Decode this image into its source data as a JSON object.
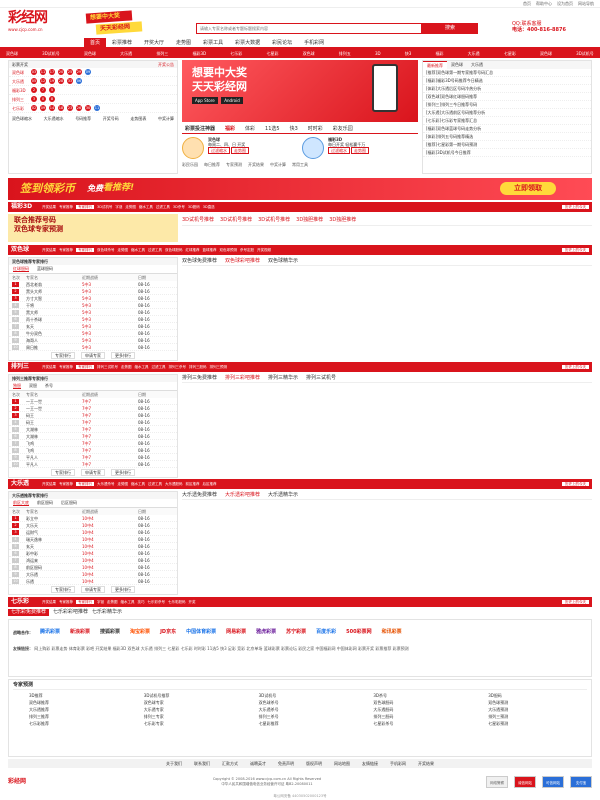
{
  "top_links": [
    "首页",
    "帮助中心",
    "设为首页",
    "网站导航"
  ],
  "header": {
    "logo_text": "彩经网",
    "logo_url": "www.cjcp.com.cn",
    "slogan1": "想要中大奖",
    "slogan2": "天天彩经网",
    "search_placeholder": "请输入专家名称或者专题标题搜索内容",
    "search_button": "搜索",
    "hotline_label": "QQ:联系客服",
    "hotline_number": "电话：400-816-8876"
  },
  "nav": {
    "items": [
      "首页",
      "彩票推荐",
      "开奖大厅",
      "走势图",
      "彩票工具",
      "彩票大数据",
      "彩民论坛",
      "手机彩网"
    ],
    "active_index": 0
  },
  "subnav": [
    "双色球",
    "3D试机号",
    "双色球",
    "大乐透",
    "排列三",
    "福彩3D",
    "七乐彩",
    "七星彩",
    "双色球",
    "排列五",
    "3D",
    "快3",
    "福彩",
    "大乐透",
    "七星彩",
    "双色球",
    "3D试机号"
  ],
  "draws": {
    "head_left": "彩票开奖",
    "head_right": "开奖公告",
    "rows": [
      {
        "name": "双色球",
        "balls": [
          "03",
          "11",
          "17",
          "20",
          "25",
          "29"
        ],
        "blue": "09"
      },
      {
        "name": "大乐透",
        "balls": [
          "05",
          "12",
          "19",
          "28",
          "33"
        ],
        "blue": "06"
      },
      {
        "name": "福彩3D",
        "balls": [
          "2",
          "7",
          "5"
        ],
        "blue": ""
      },
      {
        "name": "排列三",
        "balls": [
          "3",
          "0",
          "8"
        ],
        "blue": ""
      },
      {
        "name": "七乐彩",
        "balls": [
          "02",
          "09",
          "14",
          "18",
          "23",
          "26",
          "30"
        ],
        "blue": "11"
      }
    ],
    "tools": [
      "双色球缩水",
      "大乐透缩水",
      "号码推荐",
      "开奖号码",
      "走势图表",
      "中奖计算"
    ]
  },
  "banner": {
    "line1": "想要中大奖",
    "line2": "天天彩经网",
    "store1": "App Store",
    "store2": "Android"
  },
  "tools": {
    "title": "彩票投注神器",
    "tabs": [
      "福彩",
      "体彩",
      "11选5",
      "快3",
      "时时彩",
      "彩友乐园"
    ],
    "active": 0,
    "block1": {
      "name": "双色球",
      "desc": "每周二、四、日 开奖",
      "tags": [
        "过滤缩水",
        "走势图"
      ]
    },
    "block2": {
      "name": "福彩3D",
      "desc": "每日开奖 轻松赢千万",
      "tags": [
        "过滤缩水",
        "走势图"
      ]
    },
    "links": [
      "彩民乐园",
      "每日推荐",
      "专家预测",
      "开奖结果",
      "中奖计算",
      "常用工具"
    ]
  },
  "news": {
    "tabs": [
      "最新推荐",
      "双色球",
      "大乐透"
    ],
    "active": 0,
    "items": [
      "[推荐]双色球第一期专家推荐号码汇总",
      "[福彩]福彩3D号码推荐今日精选",
      "[体彩]大乐透后区号码冷热分析",
      "[双色球]双色球红球胆码推荐",
      "[排列三]排列三今日推荐号码",
      "[大乐透]大乐透前区号码推荐分析",
      "[七乐彩]七乐彩专家推荐汇总",
      "[福彩]双色球蓝球号码走势分析",
      "[体彩]排列五号码推荐精选",
      "[推荐]七星彩第一期号码预测",
      "[福彩]3D试机号今日推荐"
    ]
  },
  "promo": {
    "part1": "签到领彩币",
    "part2": "免费",
    "part3": "看推荐!",
    "button": "立即领取"
  },
  "sections": {
    "fc3d": {
      "name": "福彩3D",
      "links": [
        "开奖结果",
        "专家推荐",
        "专家排行",
        "3D试机号",
        "字谜",
        "走势图",
        "缩水工具",
        "过滤工具",
        "3D杀号",
        "3D胆码",
        "3D直选"
      ],
      "more": "历史上的今天",
      "ad1": "联合推荐号码",
      "ad2": "双色球专家预测",
      "tabs": [
        "3D试机号推荐",
        "3D试机号推荐",
        "3D试机号推荐",
        "3D独胆推荐",
        "3D独胆推荐"
      ]
    },
    "ssq": {
      "name": "双色球",
      "links": [
        "开奖结果",
        "专家推荐",
        "专家排行",
        "双色球杀号",
        "走势图",
        "缩水工具",
        "过滤工具",
        "双色球胆码",
        "红球推荐",
        "蓝球推荐",
        "双色球预测",
        "杀号定胆",
        "开奖视频"
      ],
      "more": "历史上的今天",
      "rank_title": "双色球推荐专家排行",
      "rank_tabs": [
        "红球胆码",
        "蓝球胆码"
      ],
      "rank_header": [
        "名次",
        "专家名",
        "近期战绩",
        "日期"
      ],
      "rank_rows": [
        [
          "1",
          "西北老翁",
          "5中3",
          "08-16"
        ],
        [
          "2",
          "黑头大师",
          "5中3",
          "08-16"
        ],
        [
          "3",
          "方寸大智",
          "5中3",
          "08-16"
        ],
        [
          "4",
          "干将",
          "5中3",
          "08-16"
        ],
        [
          "5",
          "黑大师",
          "5中3",
          "08-16"
        ],
        [
          "6",
          "丙十杀球",
          "5中3",
          "08-16"
        ],
        [
          "7",
          "玄天",
          "5中3",
          "08-16"
        ],
        [
          "8",
          "牛分双色",
          "5中3",
          "08-16"
        ],
        [
          "9",
          "海哥人",
          "5中3",
          "08-16"
        ],
        [
          "10",
          "周日推",
          "5中3",
          "08-16"
        ]
      ],
      "rank_foot": [
        "专家排行",
        "申请专家",
        "更多排行"
      ],
      "tabs": [
        "双色球免费推荐",
        "双色球彩吧推荐",
        "双色球精华示"
      ]
    },
    "pl3": {
      "name": "排列三",
      "links": [
        "开奖结果",
        "专家推荐",
        "专家排行",
        "排列三试机号",
        "走势图",
        "缩水工具",
        "过滤工具",
        "排列三杀号",
        "排列三胆码",
        "排列三预测"
      ],
      "more": "历史上的今天",
      "rank_title": "排列三推荐专家排行",
      "rank_tabs": [
        "独胆",
        "双胆",
        "杀号"
      ],
      "rank_header": [
        "名次",
        "专家名",
        "近期战绩",
        "日期"
      ],
      "rank_rows": [
        [
          "1",
          "一王一世",
          "7中7",
          "08-16"
        ],
        [
          "2",
          "一王一世",
          "7中7",
          "08-16"
        ],
        [
          "3",
          "码王",
          "7中7",
          "08-16"
        ],
        [
          "4",
          "码王",
          "7中7",
          "08-16"
        ],
        [
          "5",
          "大湖林",
          "7中7",
          "08-16"
        ],
        [
          "6",
          "大湖林",
          "7中7",
          "08-16"
        ],
        [
          "7",
          "飞鸡",
          "7中7",
          "08-16"
        ],
        [
          "8",
          "飞鸡",
          "7中7",
          "08-16"
        ],
        [
          "9",
          "平凡人",
          "7中7",
          "08-16"
        ],
        [
          "10",
          "平凡人",
          "7中7",
          "08-16"
        ]
      ],
      "rank_foot": [
        "专家排行",
        "申请专家",
        "更多排行"
      ],
      "tabs": [
        "排列三免费推荐",
        "排列三彩吧推荐",
        "排列三精华示",
        "排列三试机号"
      ]
    },
    "dlt": {
      "name": "大乐透",
      "links": [
        "开奖结果",
        "专家推荐",
        "专家排行",
        "大乐透杀号",
        "走势图",
        "缩水工具",
        "过滤工具",
        "大乐透胆码",
        "前区推荐",
        "后区推荐"
      ],
      "more": "历史上的今天",
      "rank_title": "大乐透推荐专家排行",
      "rank_tabs": [
        "前区大底",
        "前区胆码",
        "后区胆码"
      ],
      "rank_header": [
        "名次",
        "专家名",
        "近期战绩",
        "日期"
      ],
      "rank_rows": [
        [
          "1",
          "彩立中",
          "10中4",
          "08-16"
        ],
        [
          "2",
          "大乐天",
          "10中4",
          "08-16"
        ],
        [
          "3",
          "运财气",
          "10中4",
          "08-16"
        ],
        [
          "4",
          "瑞天逸林",
          "10中4",
          "08-16"
        ],
        [
          "5",
          "玄天",
          "10中4",
          "08-16"
        ],
        [
          "6",
          "彩中彩",
          "10中4",
          "08-16"
        ],
        [
          "7",
          "鸿运来",
          "10中4",
          "08-16"
        ],
        [
          "8",
          "前区胆码",
          "10中4",
          "08-16"
        ],
        [
          "9",
          "大乐透",
          "10中4",
          "08-16"
        ],
        [
          "10",
          "乐透",
          "10中4",
          "08-16"
        ]
      ],
      "rank_foot": [
        "专家排行",
        "申请专家",
        "更多排行"
      ],
      "tabs": [
        "大乐透免费推荐",
        "大乐透彩吧推荐",
        "大乐透精华示"
      ]
    },
    "qlc": {
      "name": "七乐彩",
      "links": [
        "开奖结果",
        "专家推荐",
        "专家排行",
        "字谜",
        "走势图",
        "缩水工具",
        "技巧",
        "七乐彩杀号",
        "七乐彩胆码",
        "开奖"
      ],
      "more": "历史上的今天",
      "tabs": [
        "七乐彩免费推荐",
        "七乐彩彩吧推荐",
        "七乐彩精华示"
      ]
    }
  },
  "partners": {
    "label": "战略合作：",
    "logos": [
      "腾讯彩票",
      "新浪彩票",
      "搜狐彩票",
      "淘宝彩票",
      "JD京东",
      "中国体育彩票",
      "网易彩票",
      "雅虎彩票",
      "苏宁彩票",
      "百度乐彩",
      "500彩票网",
      "和讯彩票"
    ],
    "link_label": "友情链接：",
    "links": "网上购彩 彩票走势 体育彩票 彩吧 开奖结果 福彩3D 双色球 大乐透 排列三 七星彩 七乐彩 时时彩 11选5 快3 足彩 竞彩 北京单场 篮球彩票 彩票论坛 彩民之家 中国福彩网 中国体彩网 彩票开奖 彩票推荐 彩票预测"
  },
  "expert": {
    "title": "专家预测",
    "items": [
      "3D推荐",
      "3D试机号推荐",
      "3D试机号",
      "3D杀号",
      "3D胆码",
      "双色球推荐",
      "双色球专家",
      "双色球杀号",
      "双色球胆码",
      "双色球预测",
      "大乐透推荐",
      "大乐透专家",
      "大乐透杀号",
      "大乐透胆码",
      "大乐透预测",
      "排列三推荐",
      "排列三专家",
      "排列三杀号",
      "排列三胆码",
      "排列三预测",
      "七乐彩推荐",
      "七乐彩专家",
      "七星彩推荐",
      "七星彩杀号",
      "七星彩预测"
    ]
  },
  "footer_nav": [
    "关于我们",
    "联系我们",
    "汇款方式",
    "诚聘英才",
    "免责声明",
    "版权声明",
    "网站地图",
    "友情链接",
    "手机彩网",
    "开奖结果"
  ],
  "footer": {
    "logo": "彩经网",
    "copyright": "Copyright © 2008-2016 www.cjcp.com.cn All Rights Reserved",
    "icp": "中华人民共和国增值电信业务经营许可证 粤B2-20080011",
    "badges": [
      "网络警察",
      "诚信网站",
      "可信网站",
      "支付宝"
    ],
    "police": "粤公网安备 44030502000123号"
  }
}
